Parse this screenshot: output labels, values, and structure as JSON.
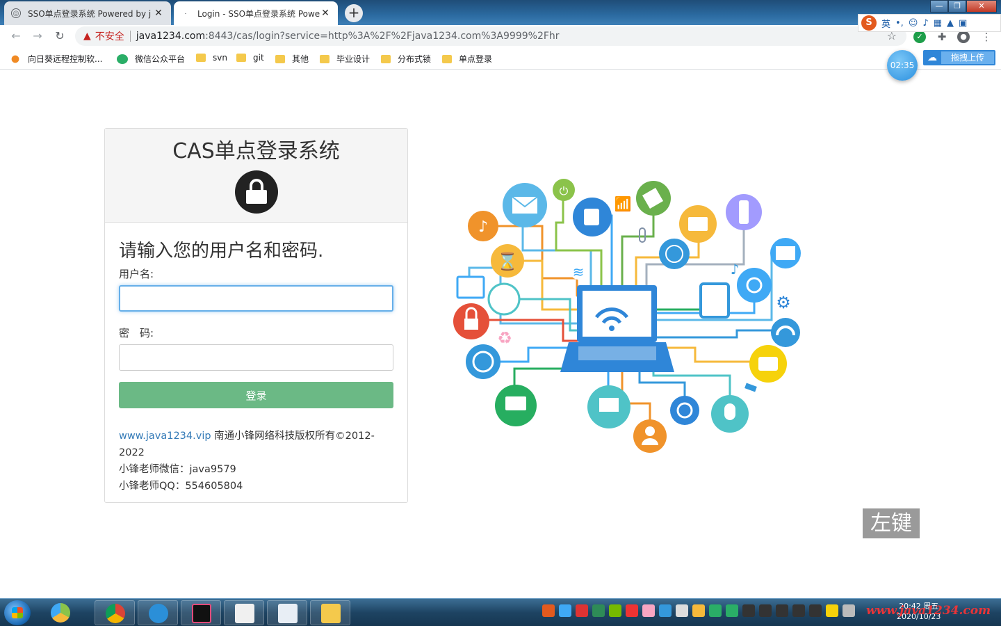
{
  "browser": {
    "tabs": [
      {
        "title": "SSO单点登录系统 Powered by j",
        "active": false
      },
      {
        "title": "Login - SSO单点登录系统 Powe",
        "active": true
      }
    ],
    "new_tab_label": "+",
    "insecure_label": "不安全",
    "url_host": "java1234.com",
    "url_rest": ":8443/cas/login?service=http%3A%2F%2Fjava1234.com%3A9999%2Fhr",
    "bookmarks": [
      {
        "label": "向日葵远程控制软...",
        "icon": "sunflower-icon"
      },
      {
        "label": "微信公众平台",
        "icon": "wechat-icon"
      },
      {
        "label": "svn",
        "icon": "folder-icon"
      },
      {
        "label": "git",
        "icon": "folder-icon"
      },
      {
        "label": "其他",
        "icon": "folder-icon"
      },
      {
        "label": "毕业设计",
        "icon": "folder-icon"
      },
      {
        "label": "分布式锁",
        "icon": "folder-icon"
      },
      {
        "label": "单点登录",
        "icon": "folder-icon"
      }
    ],
    "ime_lang": "英",
    "timer": "02:35",
    "upload_label": "拖拽上传"
  },
  "login": {
    "title": "CAS单点登录系统",
    "prompt": "请输入您的用户名和密码.",
    "username_label": "用户名:",
    "username_value": "",
    "password_label": "密　码:",
    "password_value": "",
    "submit_label": "登录",
    "footer": {
      "link_text": "www.java1234.vip",
      "copyright": " 南通小锋网络科技版权所有©2012-2022",
      "wechat": "小锋老师微信：java9579",
      "qq": "小锋老师QQ：554605804"
    }
  },
  "overlay_key": "左键",
  "taskbar": {
    "clock_time": "20:42 周五",
    "clock_date": "2020/10/23",
    "watermark": "www.java1234.com"
  },
  "colors": {
    "login_button": "#6bb985",
    "link": "#337ab7",
    "input_focus": "#66afe9"
  }
}
